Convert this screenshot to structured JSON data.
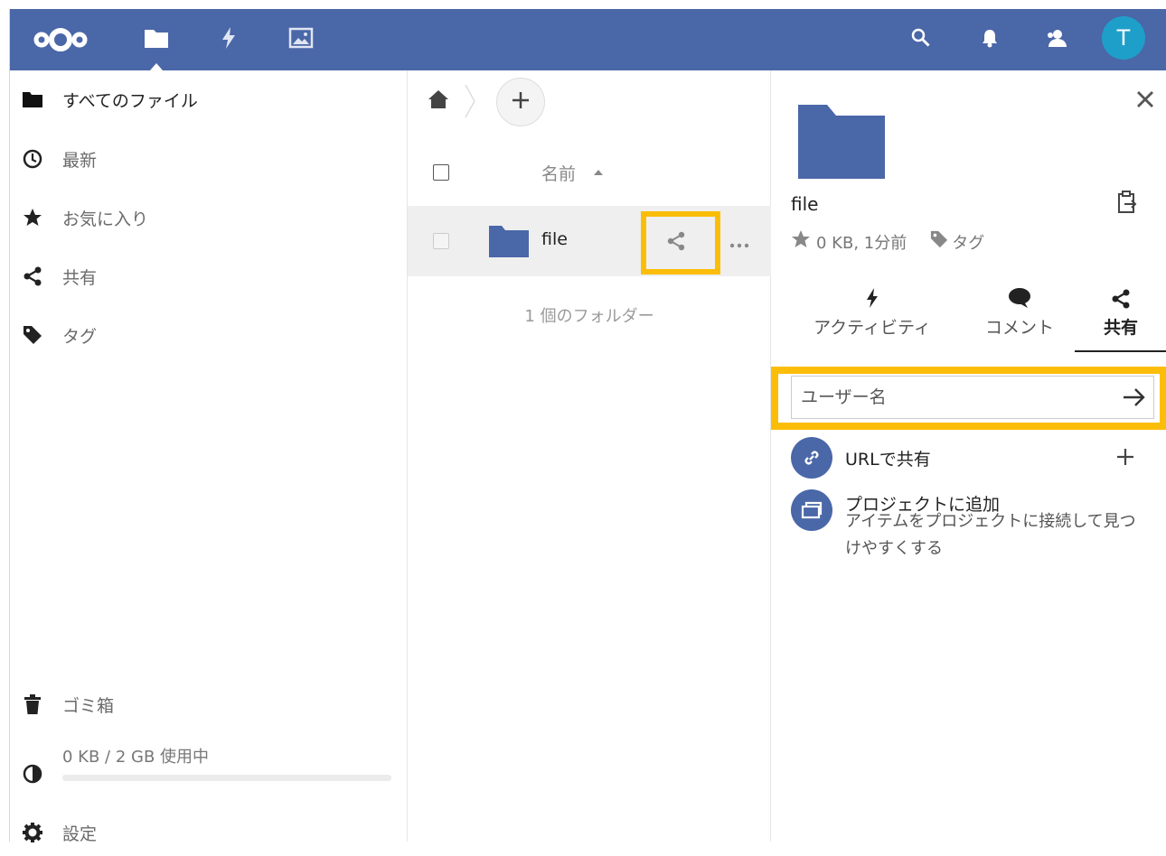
{
  "colors": {
    "topbar": "#4a67a8",
    "highlight": "#fbbd08",
    "avatar": "#1e9fc9",
    "folder": "#4a67a8"
  },
  "header": {
    "logo_icon": "nextcloud-logo",
    "apps": [
      {
        "name": "files",
        "icon": "folder-icon",
        "active": true
      },
      {
        "name": "activity",
        "icon": "lightning-icon",
        "active": false
      },
      {
        "name": "gallery",
        "icon": "image-icon",
        "active": false
      }
    ],
    "right_icons": [
      "search-icon",
      "bell-icon",
      "contacts-icon"
    ],
    "avatar_letter": "T"
  },
  "nav": {
    "items": [
      {
        "label": "すべてのファイル",
        "icon": "folder-icon"
      },
      {
        "label": "最新",
        "icon": "clock-icon"
      },
      {
        "label": "お気に入り",
        "icon": "star-icon"
      },
      {
        "label": "共有",
        "icon": "share-icon"
      },
      {
        "label": "タグ",
        "icon": "tag-icon"
      }
    ],
    "trash_label": "ゴミ箱",
    "quota_text": "0 KB / 2 GB 使用中",
    "quota_fraction": 0.0,
    "settings_label": "設定"
  },
  "files": {
    "column_name": "名前",
    "rows": [
      {
        "name": "file",
        "icon": "folder-icon"
      }
    ],
    "summary": "1 個のフォルダー"
  },
  "sidebar": {
    "title": "file",
    "meta_size": "0 KB, 1分前",
    "meta_tags": "タグ",
    "tabs": [
      {
        "label": "アクティビティ",
        "icon": "lightning-icon"
      },
      {
        "label": "コメント",
        "icon": "comment-icon"
      },
      {
        "label": "共有",
        "icon": "share-icon",
        "active": true
      }
    ],
    "share_placeholder": "ユーザー名",
    "url_share_label": "URLで共有",
    "project_title": "プロジェクトに追加",
    "project_sub_line1": "アイテムをプロジェクトに接続して見つ",
    "project_sub_line2": "けやすくする"
  }
}
